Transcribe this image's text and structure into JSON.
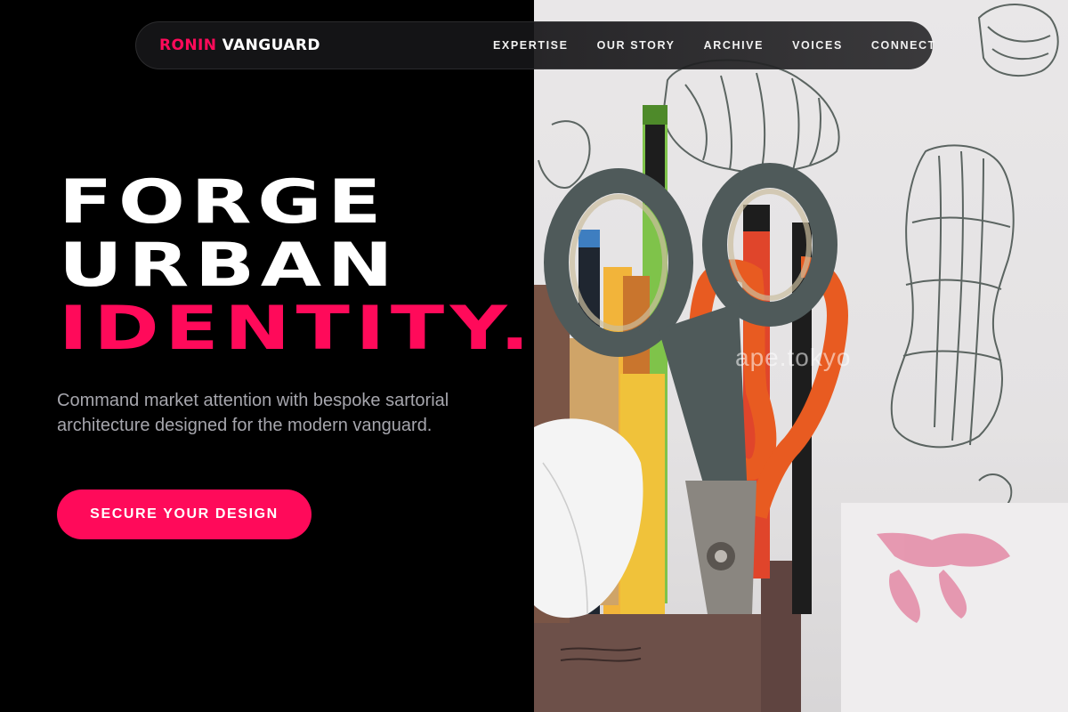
{
  "brand": {
    "part1": "RONIN",
    "part2": "VANGUARD"
  },
  "nav": {
    "links": [
      "EXPERTISE",
      "OUR STORY",
      "ARCHIVE",
      "VOICES",
      "CONNECT"
    ]
  },
  "hero": {
    "line1": "FORGE",
    "line2": "URBAN",
    "line3": "IDENTITY.",
    "subtitle": "Command market attention with bespoke sartorial architecture designed for the modern vanguard.",
    "cta": "SECURE YOUR DESIGN"
  },
  "image": {
    "watermark": "ape.tokyo"
  },
  "colors": {
    "accent": "#ff0a5a",
    "background": "#000000",
    "subtitle": "#a6a6ad"
  }
}
